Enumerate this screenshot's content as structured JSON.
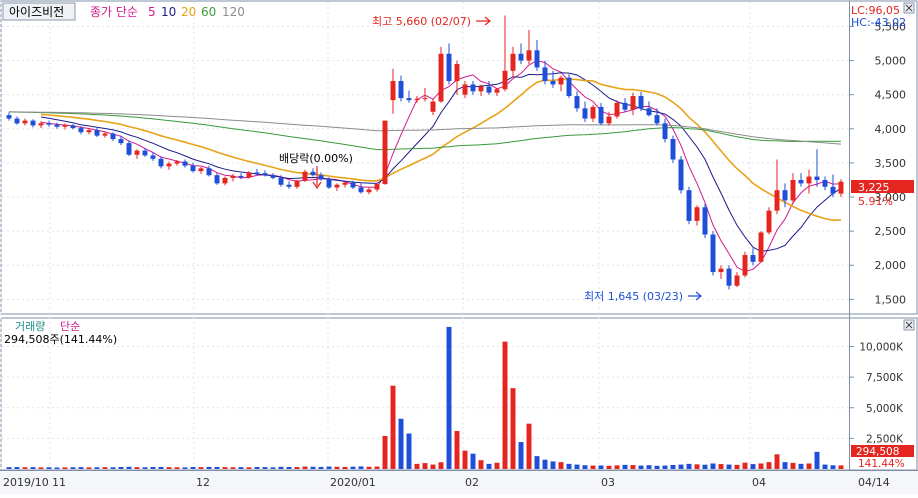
{
  "stock_name": "아이즈비전",
  "legend": {
    "title": "종가 단순",
    "periods": [
      "5",
      "10",
      "20",
      "60",
      "120"
    ]
  },
  "top_right": {
    "lc": "LC:96,05",
    "hc": "HC:-43,02"
  },
  "annotations": {
    "high": "최고 5,660 (02/07)",
    "low": "최저 1,645 (03/23)",
    "dividend": "배당락(0.00%)"
  },
  "price_tag": "3,225",
  "pct_tag": "5.91%",
  "volume": {
    "title_a": "거래량",
    "title_b": "단순",
    "info": "294,508주(141.44%)",
    "value_tag": "294,508",
    "pct_tag": "141.44%"
  },
  "colors": {
    "up": "#e5251f",
    "down": "#1f4fd8",
    "ma5": "#d01b8e",
    "ma10": "#1c1c8c",
    "ma20": "#e8a31a",
    "ma60": "#3a9a3a",
    "ma120": "#8c8c8c"
  },
  "chart_data": [
    {
      "type": "candlestick",
      "ylim": [
        1300,
        5800
      ],
      "y_ticks": [
        "1,500",
        "2,000",
        "2,500",
        "3,000",
        "3,500",
        "4,000",
        "4,500",
        "5,000",
        "5,500"
      ],
      "x_labels": [
        "2019/10",
        "11",
        "12",
        "2020/01",
        "02",
        "03",
        "04",
        "04/14"
      ],
      "ohlc": [
        [
          4200,
          4240,
          4120,
          4150
        ],
        [
          4150,
          4180,
          4060,
          4080
        ],
        [
          4080,
          4150,
          4050,
          4120
        ],
        [
          4120,
          4140,
          4020,
          4050
        ],
        [
          4050,
          4110,
          4010,
          4080
        ],
        [
          4080,
          4120,
          4030,
          4060
        ],
        [
          4060,
          4090,
          4000,
          4030
        ],
        [
          4030,
          4080,
          3990,
          4050
        ],
        [
          4050,
          4070,
          3990,
          4010
        ],
        [
          4010,
          4040,
          3920,
          3950
        ],
        [
          3950,
          4010,
          3920,
          3980
        ],
        [
          3980,
          4010,
          3880,
          3900
        ],
        [
          3900,
          3960,
          3870,
          3930
        ],
        [
          3930,
          3950,
          3820,
          3850
        ],
        [
          3850,
          3900,
          3760,
          3790
        ],
        [
          3790,
          3830,
          3600,
          3620
        ],
        [
          3620,
          3700,
          3560,
          3680
        ],
        [
          3680,
          3720,
          3590,
          3610
        ],
        [
          3610,
          3660,
          3530,
          3560
        ],
        [
          3560,
          3600,
          3420,
          3450
        ],
        [
          3450,
          3520,
          3400,
          3490
        ],
        [
          3490,
          3540,
          3460,
          3520
        ],
        [
          3520,
          3550,
          3430,
          3460
        ],
        [
          3460,
          3500,
          3360,
          3380
        ],
        [
          3380,
          3440,
          3340,
          3420
        ],
        [
          3420,
          3460,
          3300,
          3320
        ],
        [
          3320,
          3350,
          3180,
          3200
        ],
        [
          3200,
          3300,
          3170,
          3280
        ],
        [
          3280,
          3340,
          3230,
          3310
        ],
        [
          3310,
          3350,
          3260,
          3290
        ],
        [
          3290,
          3380,
          3270,
          3360
        ],
        [
          3360,
          3410,
          3320,
          3350
        ],
        [
          3350,
          3390,
          3300,
          3320
        ],
        [
          3320,
          3350,
          3260,
          3280
        ],
        [
          3280,
          3320,
          3150,
          3180
        ],
        [
          3180,
          3230,
          3120,
          3150
        ],
        [
          3150,
          3250,
          3120,
          3240
        ],
        [
          3240,
          3400,
          3220,
          3370
        ],
        [
          3370,
          3420,
          3300,
          3320
        ],
        [
          3320,
          3360,
          3240,
          3260
        ],
        [
          3260,
          3290,
          3120,
          3140
        ],
        [
          3140,
          3200,
          3090,
          3180
        ],
        [
          3180,
          3230,
          3140,
          3210
        ],
        [
          3210,
          3240,
          3120,
          3140
        ],
        [
          3140,
          3200,
          3050,
          3070
        ],
        [
          3070,
          3140,
          3040,
          3110
        ],
        [
          3110,
          3210,
          3080,
          3190
        ],
        [
          3190,
          4100,
          3180,
          4120
        ],
        [
          4420,
          4880,
          4220,
          4700
        ],
        [
          4700,
          4780,
          4400,
          4450
        ],
        [
          4450,
          4560,
          4380,
          4420
        ],
        [
          4420,
          4480,
          4380,
          4440
        ],
        [
          4440,
          4600,
          4400,
          4450
        ],
        [
          4250,
          4450,
          4200,
          4400
        ],
        [
          4400,
          5200,
          4380,
          5100
        ],
        [
          5100,
          5250,
          4650,
          4700
        ],
        [
          4700,
          5000,
          4500,
          4950
        ],
        [
          4500,
          4700,
          4450,
          4650
        ],
        [
          4650,
          4700,
          4500,
          4550
        ],
        [
          4550,
          4650,
          4480,
          4620
        ],
        [
          4620,
          4700,
          4500,
          4530
        ],
        [
          4530,
          4600,
          4480,
          4580
        ],
        [
          4580,
          5660,
          4550,
          4850
        ],
        [
          4850,
          5200,
          4750,
          5100
        ],
        [
          5100,
          5250,
          4950,
          5000
        ],
        [
          5000,
          5450,
          4950,
          5150
        ],
        [
          5150,
          5300,
          4850,
          4900
        ],
        [
          4900,
          5000,
          4650,
          4700
        ],
        [
          4700,
          4850,
          4600,
          4650
        ],
        [
          4650,
          4780,
          4550,
          4750
        ],
        [
          4750,
          4800,
          4450,
          4480
        ],
        [
          4480,
          4550,
          4250,
          4300
        ],
        [
          4300,
          4400,
          4100,
          4150
        ],
        [
          4150,
          4350,
          4100,
          4320
        ],
        [
          4320,
          4380,
          4050,
          4080
        ],
        [
          4080,
          4250,
          4050,
          4180
        ],
        [
          4180,
          4420,
          4150,
          4380
        ],
        [
          4380,
          4450,
          4250,
          4280
        ],
        [
          4280,
          4530,
          4200,
          4480
        ],
        [
          4480,
          4540,
          4260,
          4300
        ],
        [
          4300,
          4400,
          4180,
          4200
        ],
        [
          4200,
          4300,
          4050,
          4080
        ],
        [
          4080,
          4150,
          3800,
          3850
        ],
        [
          3850,
          3900,
          3500,
          3550
        ],
        [
          3550,
          3600,
          3050,
          3100
        ],
        [
          3100,
          3150,
          2600,
          2650
        ],
        [
          2650,
          2880,
          2580,
          2850
        ],
        [
          2850,
          2900,
          2400,
          2450
        ],
        [
          2450,
          2500,
          1850,
          1900
        ],
        [
          1900,
          2000,
          1800,
          1950
        ],
        [
          1950,
          2000,
          1645,
          1700
        ],
        [
          1700,
          1900,
          1680,
          1850
        ],
        [
          1850,
          2200,
          1820,
          2150
        ],
        [
          2150,
          2250,
          2000,
          2050
        ],
        [
          2050,
          2500,
          2050,
          2480
        ],
        [
          2480,
          2850,
          2450,
          2800
        ],
        [
          2800,
          3550,
          2750,
          3100
        ],
        [
          3100,
          3200,
          2850,
          2950
        ],
        [
          2950,
          3350,
          2900,
          3250
        ],
        [
          3250,
          3350,
          3150,
          3200
        ],
        [
          3200,
          3400,
          3050,
          3300
        ],
        [
          3300,
          3700,
          3150,
          3250
        ],
        [
          3250,
          3300,
          3100,
          3150
        ],
        [
          3150,
          3330,
          3000,
          3050
        ],
        [
          3050,
          3260,
          3000,
          3225
        ]
      ]
    },
    {
      "type": "bar",
      "ylim": [
        0,
        12000
      ],
      "unit": "K",
      "y_ticks": [
        "2,500K",
        "5,000K",
        "7,500K",
        "10,000K"
      ],
      "volumes": [
        150,
        160,
        140,
        150,
        130,
        140,
        120,
        130,
        140,
        150,
        130,
        140,
        150,
        140,
        160,
        180,
        150,
        140,
        160,
        170,
        150,
        140,
        130,
        160,
        150,
        170,
        160,
        150,
        140,
        150,
        140,
        160,
        150,
        130,
        180,
        170,
        160,
        200,
        180,
        170,
        200,
        180,
        170,
        190,
        210,
        180,
        200,
        2700,
        6800,
        4100,
        2900,
        420,
        480,
        360,
        550,
        11600,
        3100,
        1500,
        1250,
        720,
        420,
        510,
        10400,
        6600,
        2200,
        3700,
        1050,
        760,
        620,
        560,
        420,
        360,
        310,
        280,
        290,
        260,
        300,
        340,
        320,
        280,
        310,
        260,
        280,
        330,
        360,
        420,
        380,
        350,
        450,
        400,
        360,
        340,
        520,
        400,
        450,
        560,
        1200,
        560,
        500,
        420,
        450,
        1400,
        360,
        300,
        295
      ]
    }
  ]
}
